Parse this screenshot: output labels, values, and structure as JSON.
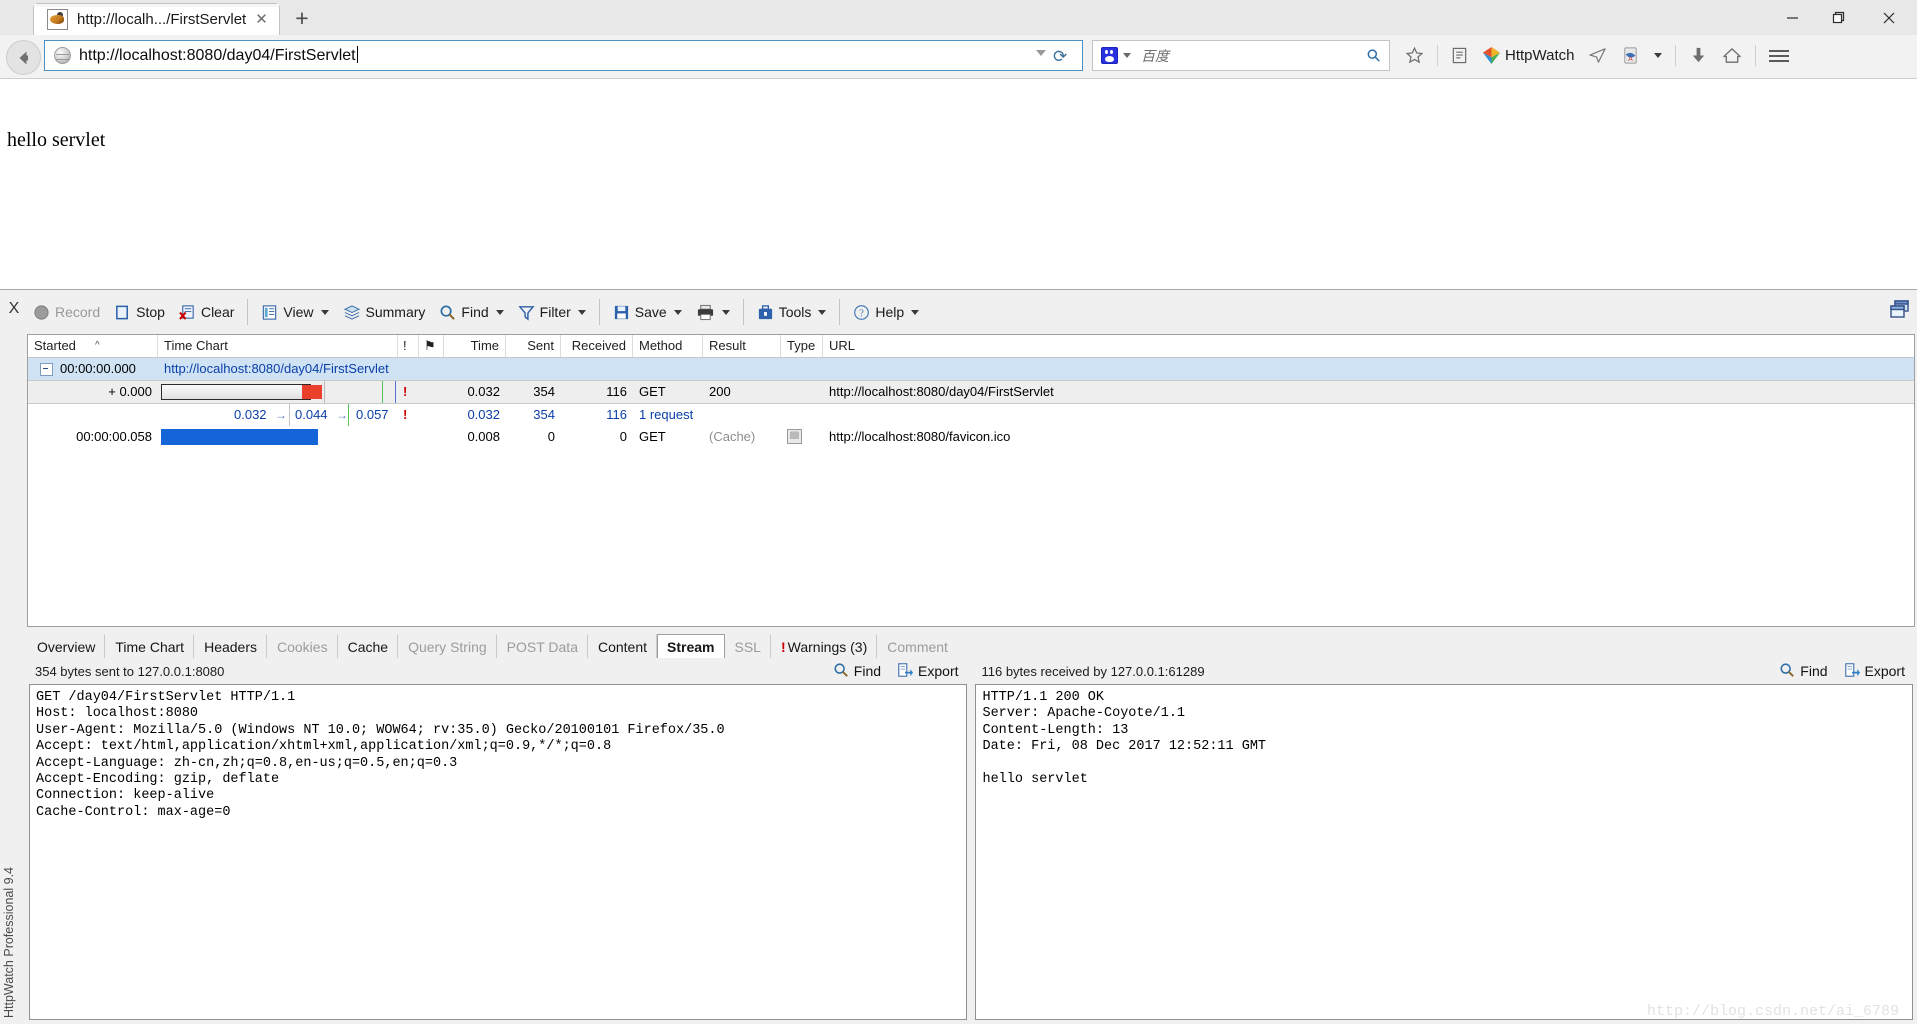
{
  "browser": {
    "tab": {
      "title": "http://localh.../FirstServlet",
      "favicon_icon": "firefox-tab-favicon",
      "close_icon": "close-icon"
    },
    "new_tab_label": "+",
    "window_controls": {
      "minimize": "minimize-icon",
      "restore": "restore-icon",
      "close": "close-icon"
    },
    "back_button_icon": "back-arrow-icon",
    "address_bar": {
      "value": "http://localhost:8080/day04/FirstServlet",
      "site_icon": "globe-icon",
      "dropdown_icon": "chevron-down-icon",
      "reload_icon": "reload-icon"
    },
    "search_bar": {
      "engine_icon": "baidu-paw-icon",
      "engine_dropdown_icon": "chevron-down-icon",
      "placeholder": "百度",
      "search_icon": "search-icon"
    },
    "toolbar_items": [
      {
        "name": "bookmark-star-icon",
        "label": ""
      },
      {
        "name": "reading-list-icon",
        "label": ""
      },
      {
        "name": "httpwatch-logo-icon",
        "label": "HttpWatch"
      },
      {
        "name": "paper-plane-icon",
        "label": ""
      },
      {
        "name": "pdf-icon",
        "label": ""
      },
      {
        "name": "chevron-down-icon",
        "label": ""
      },
      {
        "name": "download-icon",
        "label": ""
      },
      {
        "name": "home-icon",
        "label": ""
      },
      {
        "name": "menu-hamburger-icon",
        "label": ""
      }
    ]
  },
  "page": {
    "body_text": "hello servlet"
  },
  "httpwatch": {
    "close_label": "X",
    "restore_icon": "restore-panel-icon",
    "toolbar": [
      {
        "name": "record",
        "label": "Record",
        "icon": "record-circle-icon",
        "disabled": true,
        "dropdown": false
      },
      {
        "name": "stop",
        "label": "Stop",
        "icon": "stop-square-icon",
        "disabled": false,
        "dropdown": false
      },
      {
        "name": "clear",
        "label": "Clear",
        "icon": "clear-icon",
        "disabled": false,
        "dropdown": false
      },
      {
        "name": "view",
        "label": "View",
        "icon": "view-list-icon",
        "disabled": false,
        "dropdown": true
      },
      {
        "name": "summary",
        "label": "Summary",
        "icon": "summary-layers-icon",
        "disabled": false,
        "dropdown": false
      },
      {
        "name": "find",
        "label": "Find",
        "icon": "search-icon",
        "disabled": false,
        "dropdown": true
      },
      {
        "name": "filter",
        "label": "Filter",
        "icon": "funnel-icon",
        "disabled": false,
        "dropdown": true
      },
      {
        "name": "save",
        "label": "Save",
        "icon": "floppy-disk-icon",
        "disabled": false,
        "dropdown": true
      },
      {
        "name": "print",
        "label": "",
        "icon": "printer-icon",
        "disabled": false,
        "dropdown": true
      },
      {
        "name": "tools",
        "label": "Tools",
        "icon": "toolbox-icon",
        "disabled": false,
        "dropdown": true
      },
      {
        "name": "help",
        "label": "Help",
        "icon": "help-question-icon",
        "disabled": false,
        "dropdown": true
      }
    ],
    "grid": {
      "columns": [
        "Started",
        "Time Chart",
        "!",
        "⚑",
        "Time",
        "Sent",
        "Received",
        "Method",
        "Result",
        "Type",
        "URL"
      ],
      "sort_column": "Started",
      "rows": [
        {
          "kind": "group",
          "started": "00:00:00.000",
          "url": "http://localhost:8080/day04/FirstServlet",
          "expander": true
        },
        {
          "kind": "request",
          "started": "+ 0.000",
          "warning": "!",
          "time": "0.032",
          "sent": "354",
          "received": "116",
          "method": "GET",
          "result": "200",
          "type": "",
          "url": "http://localhost:8080/day04/FirstServlet",
          "selected": true
        },
        {
          "kind": "summary",
          "ticks": [
            "0.032",
            "0.044",
            "0.057"
          ],
          "warning": "!",
          "time": "0.032",
          "sent": "354",
          "received": "116",
          "method": "1 request",
          "result": "",
          "type": "",
          "url": ""
        },
        {
          "kind": "request",
          "started": "00:00:00.058",
          "warning": "",
          "time": "0.008",
          "sent": "0",
          "received": "0",
          "method": "GET",
          "result": "(Cache)",
          "type": "favicon-image-icon",
          "url": "http://localhost:8080/favicon.ico",
          "selected": false
        }
      ]
    },
    "detail_tabs": [
      {
        "label": "Overview",
        "state": "enabled"
      },
      {
        "label": "Time Chart",
        "state": "enabled"
      },
      {
        "label": "Headers",
        "state": "enabled"
      },
      {
        "label": "Cookies",
        "state": "disabled"
      },
      {
        "label": "Cache",
        "state": "enabled"
      },
      {
        "label": "Query String",
        "state": "disabled"
      },
      {
        "label": "POST Data",
        "state": "disabled"
      },
      {
        "label": "Content",
        "state": "enabled"
      },
      {
        "label": "Stream",
        "state": "active"
      },
      {
        "label": "SSL",
        "state": "disabled"
      },
      {
        "label": "Warnings (3)",
        "state": "warning"
      },
      {
        "label": "Comment",
        "state": "disabled"
      }
    ],
    "request_pane": {
      "status": "354 bytes sent to 127.0.0.1:8080",
      "find_label": "Find",
      "export_label": "Export",
      "find_icon": "search-icon",
      "export_icon": "export-icon",
      "text": "GET /day04/FirstServlet HTTP/1.1\nHost: localhost:8080\nUser-Agent: Mozilla/5.0 (Windows NT 10.0; WOW64; rv:35.0) Gecko/20100101 Firefox/35.0\nAccept: text/html,application/xhtml+xml,application/xml;q=0.9,*/*;q=0.8\nAccept-Language: zh-cn,zh;q=0.8,en-us;q=0.5,en;q=0.3\nAccept-Encoding: gzip, deflate\nConnection: keep-alive\nCache-Control: max-age=0"
    },
    "response_pane": {
      "status": "116 bytes received by 127.0.0.1:61289",
      "find_label": "Find",
      "export_label": "Export",
      "find_icon": "search-icon",
      "export_icon": "export-icon",
      "text": "HTTP/1.1 200 OK\nServer: Apache-Coyote/1.1\nContent-Length: 13\nDate: Fri, 08 Dec 2017 12:52:11 GMT\n\nhello servlet"
    },
    "product_label": "HttpWatch Professional 9.4"
  },
  "watermark": "http://blog.csdn.net/ai_6789",
  "colors": {
    "accent_blue": "#1565d8",
    "bar_red": "#e8402a",
    "selection_blue": "#cfe3f5",
    "warning_red": "#cc0000",
    "link_blue": "#0a3fa8"
  }
}
